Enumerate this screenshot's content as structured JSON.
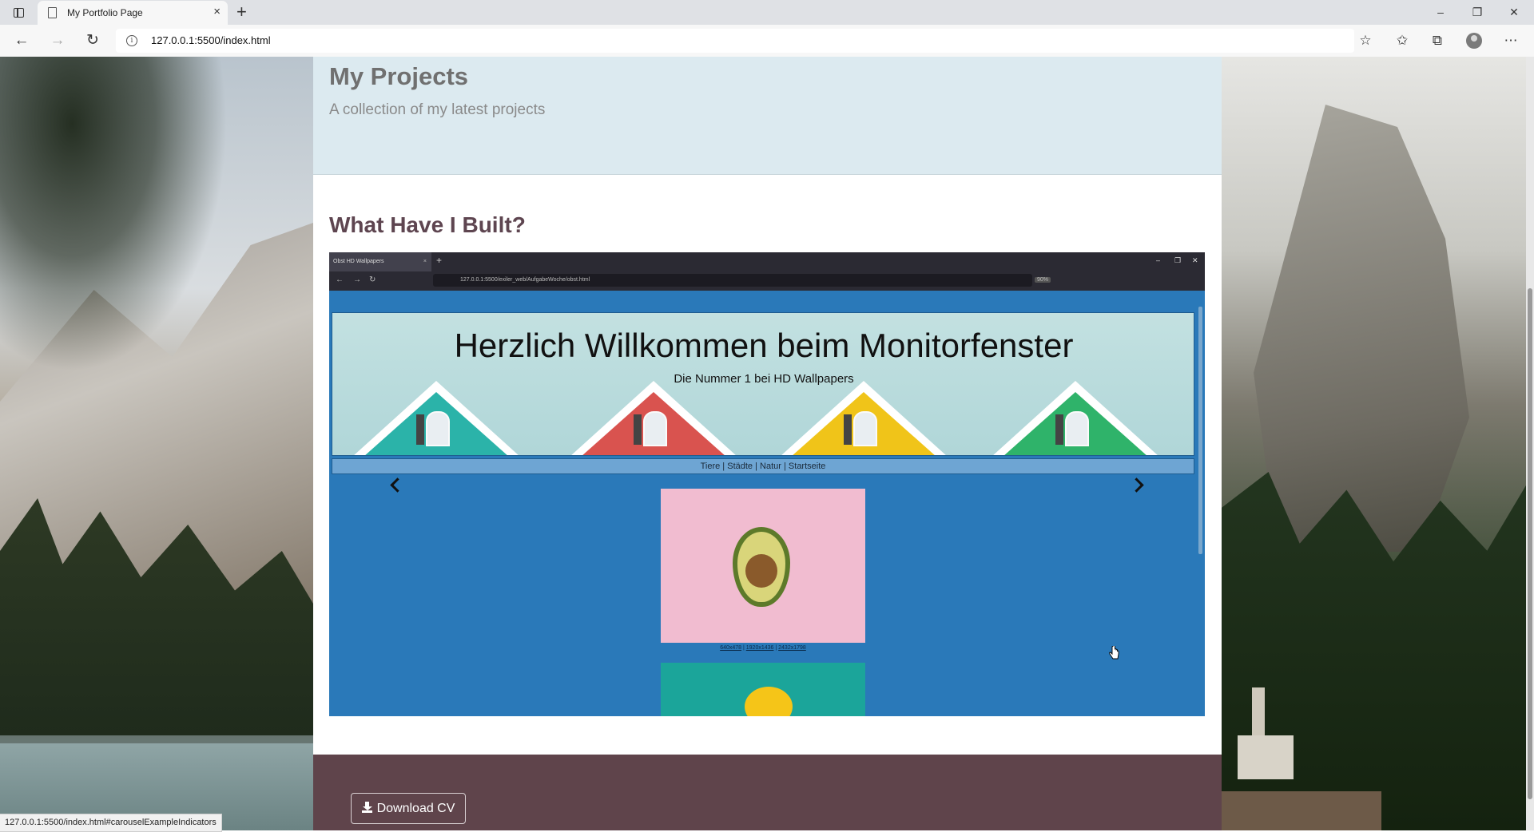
{
  "browser": {
    "tab_title": "My Portfolio Page",
    "tab_close": "×",
    "new_tab": "+",
    "url": "127.0.0.1:5500/index.html",
    "window_controls": [
      "–",
      "❐",
      "✕"
    ],
    "nav_icons": [
      "back-icon",
      "forward-icon",
      "refresh-icon"
    ],
    "status_url": "127.0.0.1:5500/index.html#carouselExampleIndicators"
  },
  "page": {
    "header": {
      "title": "My Projects",
      "subtitle": "A collection of my latest projects"
    },
    "section_title": "What Have I Built?",
    "carousel": {
      "slide": {
        "browser_tab": "Obst HD Wallpapers",
        "browser_url": "127.0.0.1:5500/exiler_web/AufgabeWoche/obst.html",
        "zoom": "90%",
        "banner_title": "Herzlich Willkommen beim Monitorfenster",
        "banner_subtitle": "Die Nummer 1 bei HD Wallpapers",
        "nav_links": [
          "Tiere",
          "Städte",
          "Natur",
          "Startseite"
        ],
        "image_links": [
          "640x478",
          "1920x1436",
          "2432x1798"
        ]
      },
      "house_colors": [
        "#2bb3a9",
        "#d9534f",
        "#f0c419",
        "#2fb36a"
      ]
    },
    "download_cv_label": "Download CV"
  },
  "colors": {
    "header_band": "#dceaf0",
    "section_heading": "#5e4550",
    "carousel_bg": "#2a79b9",
    "footer_band": "#5f444b"
  }
}
